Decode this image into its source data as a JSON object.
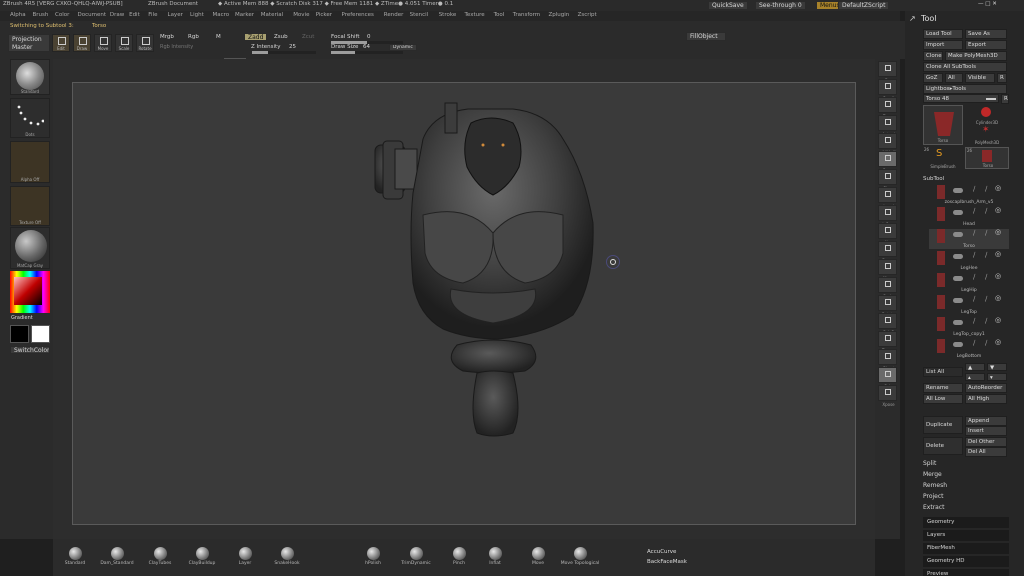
{
  "titlebar": {
    "app": "ZBrush 4R5 [VERG CXKO-QHLQ-AIWJ-PSUB]",
    "document": "ZBrush Document",
    "active_mem": "◆ Active Mem 888 ◆ Scratch Disk 317 ◆ Free Mem 1181 ◆ ZTime● 4.051 Timer● 0.1",
    "quicksave": "QuickSave",
    "seethrough": "See-through  0",
    "menus": "Menus",
    "defaultscript": "DefaultZScript"
  },
  "menubar": [
    "Alpha",
    "Brush",
    "Color",
    "Document",
    "Draw",
    "Edit",
    "File",
    "Layer",
    "Light",
    "Macro",
    "Marker",
    "Material",
    "Movie",
    "Picker",
    "Preferences",
    "Render",
    "Stencil",
    "Stroke",
    "Texture",
    "Tool",
    "Transform",
    "Zplugin",
    "Zscript"
  ],
  "topshelf": {
    "status": "Switching to Subtool 3:",
    "status_target": "Torso",
    "projection_master": "Projection Master",
    "modes": [
      {
        "label": "Edit",
        "icon": "edit-icon",
        "on": true
      },
      {
        "label": "Draw",
        "icon": "draw-icon",
        "on": true
      },
      {
        "label": "Move",
        "icon": "move-icon",
        "on": false
      },
      {
        "label": "Scale",
        "icon": "scale-icon",
        "on": false
      },
      {
        "label": "Rotate",
        "icon": "rotate-icon",
        "on": false
      }
    ],
    "mrgb": "Mrgb",
    "rgb": "Rgb",
    "m": "M",
    "rgb_intensity": "Rgb Intensity",
    "zadd": "Zadd",
    "zsub": "Zsub",
    "zcut": "Zcut",
    "z_intensity_label": "Z Intensity",
    "z_intensity": 25,
    "focal_shift_label": "Focal Shift",
    "focal_shift": 0,
    "draw_size_label": "Draw Size",
    "draw_size": 64,
    "dynamic": "Dynamic",
    "fillobject": "FillObject"
  },
  "leftshelf": {
    "brush": "Standard",
    "stroke": "Dots",
    "alpha": "Alpha Off",
    "texture": "Texture Off",
    "material": "MatCap Gray",
    "gradient": "Gradient",
    "switchcolor": "SwitchColor"
  },
  "rightshelf": [
    "Bpr",
    "Scroll",
    "Zoom",
    "Actual",
    "AAHalf",
    "Persp",
    "Floor",
    "Local",
    "L.Sym",
    "Xyz",
    "Frame",
    "Move",
    "Scale",
    "Rotate",
    "PolyF",
    "Transp",
    "Ghost",
    "Solo",
    "Xpose"
  ],
  "toolpanel": {
    "title": "Tool",
    "load_tool": "Load Tool",
    "save_as": "Save As",
    "import": "Import",
    "export": "Export",
    "clone": "Clone",
    "make_polymesh": "Make PolyMesh3D",
    "clone_all": "Clone  All SubTools",
    "goz": "GoZ",
    "all": "All",
    "visible": "Visible",
    "r": "R",
    "lightbox_tools": "Lightbox▸Tools",
    "torso_slider_label": "Torso",
    "torso_slider_value": "48",
    "tools": [
      {
        "name": "Torso"
      },
      {
        "name": "Cylinder3D"
      },
      {
        "name": "PolyMesh3D"
      },
      {
        "name": "SimpleBrush"
      },
      {
        "name": "Torso"
      }
    ],
    "count_a": "26",
    "count_b": "26",
    "subtool_header": "SubTool",
    "subtools": [
      {
        "name": "zoscaplbrush_Arm_v5",
        "sel": false
      },
      {
        "name": "Head",
        "sel": false
      },
      {
        "name": "Torso",
        "sel": true
      },
      {
        "name": "LegHee",
        "sel": false
      },
      {
        "name": "LegHip",
        "sel": false
      },
      {
        "name": "LegTop",
        "sel": false
      },
      {
        "name": "LegTop_copy1",
        "sel": false
      },
      {
        "name": "LegBottom",
        "sel": false
      }
    ],
    "list_all": "List  All",
    "rename": "Rename",
    "autoreorder": "AutoReorder",
    "all_low": "All Low",
    "all_high": "All High",
    "duplicate": "Duplicate",
    "append": "Append",
    "insert": "Insert",
    "delete": "Delete",
    "del_other": "Del Other",
    "del_all": "Del All",
    "split": "Split",
    "merge": "Merge",
    "remesh": "Remesh",
    "project": "Project",
    "extract": "Extract",
    "sections": [
      "Geometry",
      "Layers",
      "FiberMesh",
      "Geometry HD",
      "Preview"
    ]
  },
  "bottomshelf": {
    "brushes": [
      "Standard",
      "Dam_Standard",
      "ClayTubes",
      "ClayBuildup",
      "Layer",
      "SnakeHook",
      "hPolish",
      "TrimDynamic",
      "Pinch",
      "Inflat",
      "Move",
      "Move Topological"
    ],
    "accucurve": "AccuCurve",
    "backfacemask": "BackFaceMask"
  }
}
